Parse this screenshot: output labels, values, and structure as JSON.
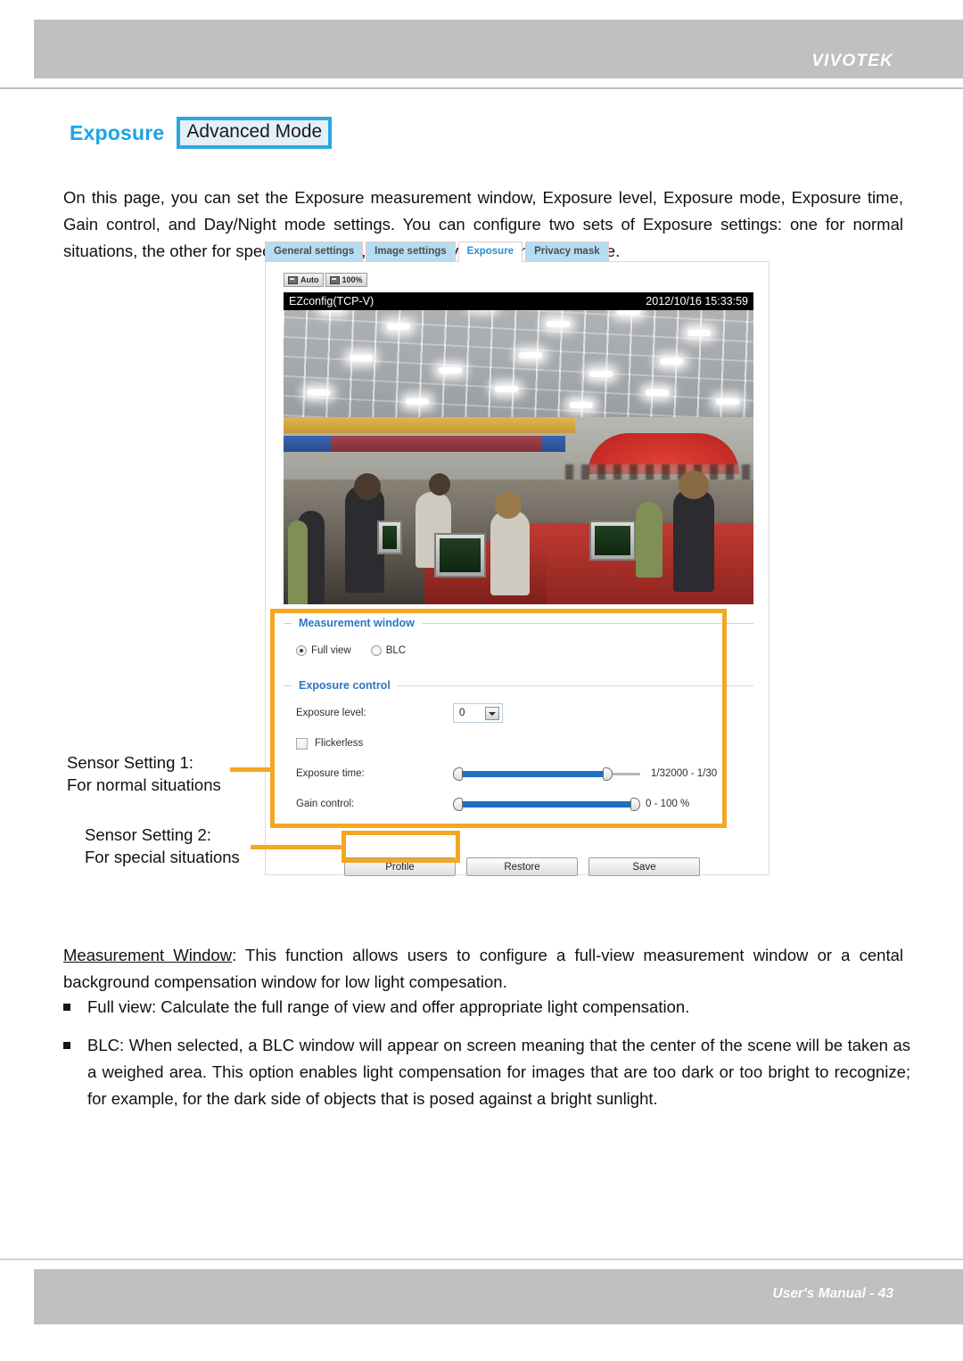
{
  "header": {
    "brand": "VIVOTEK"
  },
  "title": {
    "main": "Exposure",
    "badge": "Advanced Mode"
  },
  "body": {
    "intro": "On this page, you can set the Exposure measurement window, Exposure level, Exposure mode, Exposure time, Gain control, and Day/Night mode settings. You can configure two sets of Exposure settings: one for normal situations, the other for special situations, such as day/night/schedule mode.",
    "measurement_window_term": "Measurement Window",
    "measurement_window_rest": ": This function allows users to configure a full-view measurement window or a cental background compensation window for low light compesation.",
    "bullet_full_view": "Full view: Calculate the full range of view and offer appropriate light compensation.",
    "bullet_blc": "BLC: When selected, a BLC window will appear on screen meaning that the center of the scene will be taken as a weighed area. This option enables light compensation for images that are too dark or too bright to recognize; for example, for the dark side of objects that is posed against a bright sunlight."
  },
  "callouts": {
    "sensor1_line1": "Sensor Setting 1:",
    "sensor1_line2": "For normal situations",
    "sensor2_line1": "Sensor Setting 2:",
    "sensor2_line2": "For special situations",
    "highlight_color": "#f5a623"
  },
  "screenshot": {
    "tabs": [
      {
        "label": "General settings",
        "active": false
      },
      {
        "label": "Image settings",
        "active": false
      },
      {
        "label": "Exposure",
        "active": true
      },
      {
        "label": "Privacy mask",
        "active": false
      }
    ],
    "video_toolbar": [
      {
        "label": "Auto",
        "icon": "video-auto-icon"
      },
      {
        "label": "100%",
        "icon": "video-zoom-icon"
      }
    ],
    "video_osd": {
      "stream_name": "EZconfig(TCP-V)",
      "timestamp": "2012/10/16 15:33:59"
    },
    "measurement_window": {
      "legend": "Measurement window",
      "options": [
        {
          "label": "Full view",
          "selected": true
        },
        {
          "label": "BLC",
          "selected": false
        }
      ]
    },
    "exposure_control": {
      "legend": "Exposure control",
      "exposure_level_label": "Exposure level:",
      "exposure_level_value": "0",
      "flickerless_label": "Flickerless",
      "flickerless_checked": false,
      "exposure_time_label": "Exposure time:",
      "exposure_time_range": "1/32000 - 1/30",
      "exposure_time_fill_percent": 82,
      "gain_control_label": "Gain control:",
      "gain_control_range": "0 - 100 %",
      "gain_control_fill_percent": 100
    },
    "buttons": [
      {
        "label": "Profile"
      },
      {
        "label": "Restore"
      },
      {
        "label": "Save"
      }
    ]
  },
  "footer": {
    "text": "User's Manual - 43"
  }
}
